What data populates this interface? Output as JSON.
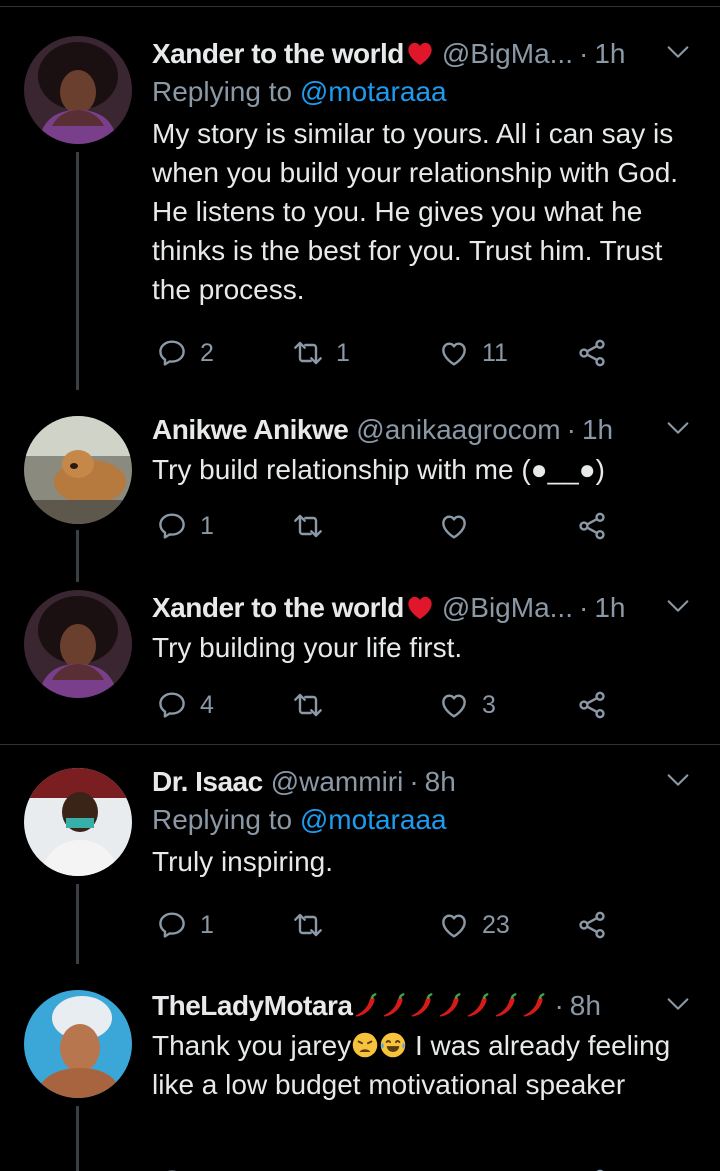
{
  "tweets": [
    {
      "name": "Xander to the world",
      "handle": "@BigMa...",
      "time": "1h",
      "reply_label": "Replying to",
      "reply_handle": "@motaraaa",
      "text": "My story is similar to yours. All i can say is when you build your relationship with God. He listens to you. He gives you what he thinks is the best for you. Trust him. Trust the process.",
      "replies": "2",
      "retweets": "1",
      "likes": "11"
    },
    {
      "name": "Anikwe Anikwe",
      "handle": "@anikaagrocom",
      "time": "1h",
      "text": "Try build relationship with me (●__●)",
      "replies": "1",
      "retweets": "",
      "likes": ""
    },
    {
      "name": "Xander to the world",
      "handle": "@BigMa...",
      "time": "1h",
      "text": "Try building your life first.",
      "replies": "4",
      "retweets": "",
      "likes": "3"
    },
    {
      "name": "Dr. Isaac",
      "handle": "@wammiri",
      "time": "8h",
      "reply_label": "Replying to",
      "reply_handle": "@motaraaa",
      "text": "Truly inspiring.",
      "replies": "1",
      "retweets": "",
      "likes": "23"
    },
    {
      "name": "TheLadyMotara",
      "time": "8h",
      "text_part1": "Thank you jarey",
      "text_part2": " I was already feeling like a low budget motivational speaker"
    }
  ],
  "icons": {
    "reply": "reply-icon",
    "retweet": "retweet-icon",
    "like": "heart-icon",
    "share": "share-icon",
    "more": "chevron-down-icon",
    "heart_emoji": "red-heart-emoji",
    "pepper": "hot-pepper-emoji",
    "weary": "weary-face-emoji",
    "laugh": "tears-of-joy-emoji"
  },
  "colors": {
    "background": "#000000",
    "link": "#1d9bf0",
    "muted": "#8b98a5",
    "text": "#e7e9ea"
  }
}
